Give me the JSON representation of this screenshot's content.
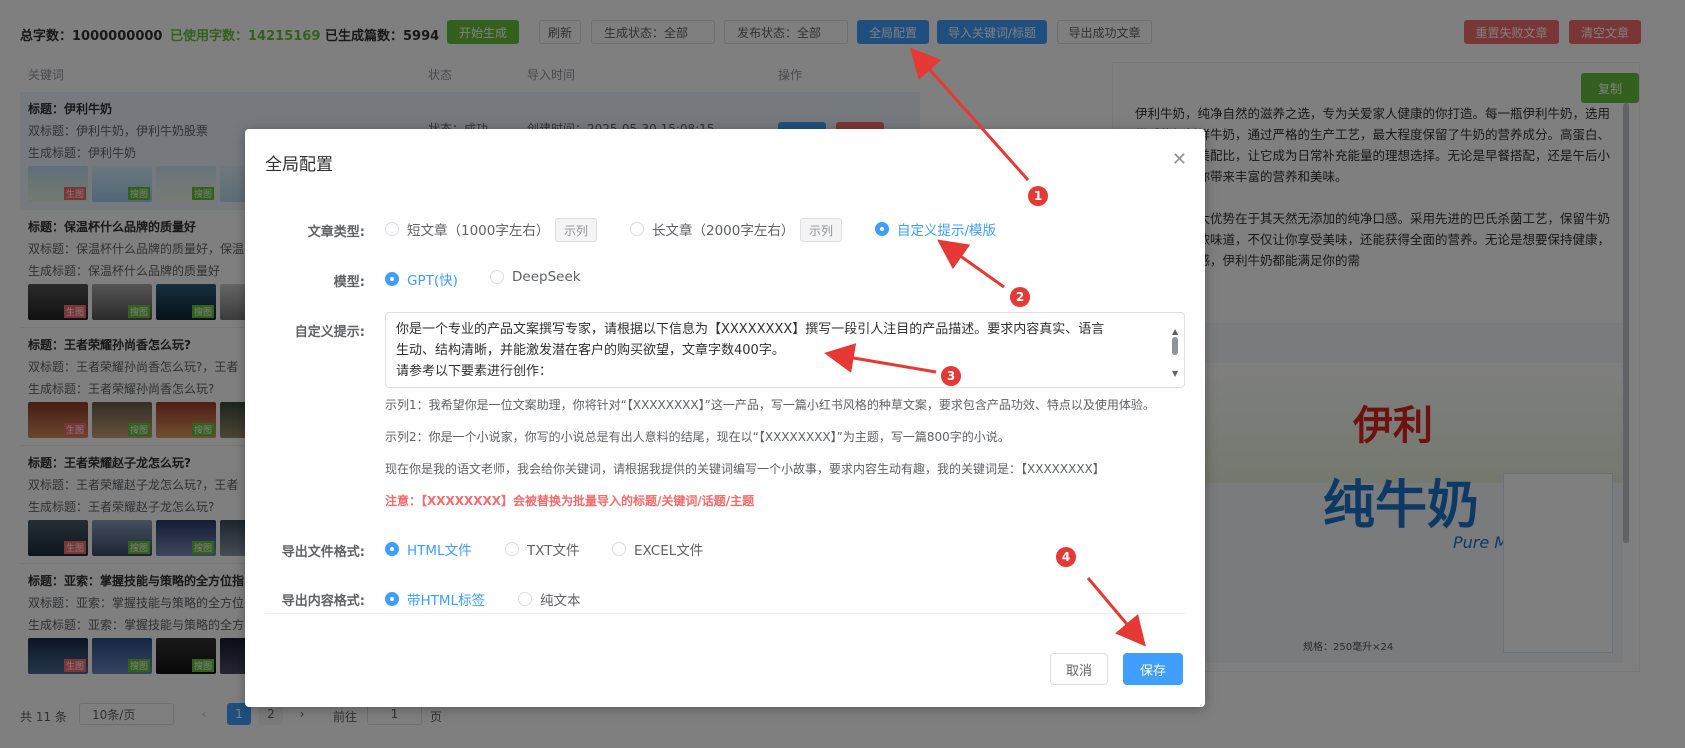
{
  "topbar": {
    "total_chars": "总字数：1000000000",
    "used_chars_label": "已使用字数：",
    "used_chars_value": "14215169",
    "generated_count": "已生成篇数：5994",
    "start_btn": "开始生成",
    "refresh_btn": "刷新",
    "gen_status": "生成状态：全部",
    "pub_status": "发布状态：全部",
    "global_config_btn": "全局配置",
    "import_btn": "导入关键词/标题",
    "export_btn": "导出成功文章",
    "reset_failed_btn": "重置失败文章",
    "clear_btn": "清空文章"
  },
  "table": {
    "headers": [
      "关键词",
      "状态",
      "导入时间",
      "操作"
    ],
    "rows": [
      {
        "title": "标题：伊利牛奶",
        "sub": "双标题：伊利牛奶，伊利牛奶股票",
        "gen": "生成标题：伊利牛奶",
        "status": "状态：成功",
        "time": "创建时间：2025-05-30 15:08:15"
      },
      {
        "title": "标题：保温杯什么品牌的质量好",
        "sub": "双标题：保温杯什么品牌的质量好，保温",
        "gen": "生成标题：保温杯什么品牌的质量好"
      },
      {
        "title": "标题：王者荣耀孙尚香怎么玩?",
        "sub": "双标题：王者荣耀孙尚香怎么玩?，王者",
        "gen": "生成标题：王者荣耀孙尚香怎么玩?"
      },
      {
        "title": "标题：王者荣耀赵子龙怎么玩?",
        "sub": "双标题：王者荣耀赵子龙怎么玩?，王者",
        "gen": "生成标题：王者荣耀赵子龙怎么玩?"
      },
      {
        "title": "标题：亚索：掌握技能与策略的全方位指",
        "sub": "双标题：亚索：掌握技能与策略的全方位",
        "gen": "生成标题：亚索：掌握技能与策略的全方"
      }
    ],
    "tag_main": "生图",
    "tag_search": "搜图"
  },
  "preview": {
    "copy_btn": "复制",
    "para1": "伊利牛奶，纯净自然的滋养之选，专为关爱家人健康的你打造。每一瓶伊利牛奶，选用优质牧场新鲜牛奶，通过严格的生产工艺，最大程度保留了牛奶的营养成分。高蛋白、低脂肪的完美配比，让它成为日常补充能量的理想选择。无论是早餐搭配，还是午后小憩，都能为你带来丰富的营养和美味。",
    "para2": "伊利牛奶最大优势在于其天然无添加的纯净口感。采用先进的巴氏杀菌工艺，保留牛奶最天然的香浓味道，不仅让你享受美味，还能获得全面的营养。无论是想要保持健康，还是追求口感，伊利牛奶都能满足你的需",
    "brand": "伊利",
    "product": "纯牛奶",
    "product_en": "Pure Milk",
    "spec": "规格：250毫升×24"
  },
  "pager": {
    "total": "共 11 条",
    "page_size": "10条/页",
    "pages": [
      "1",
      "2"
    ],
    "goto_label": "前往",
    "goto_value": "1",
    "page_unit": "页"
  },
  "dialog": {
    "title": "全局配置",
    "article_type_label": "文章类型:",
    "opt_short": "短文章（1000字左右）",
    "opt_long": "长文章（2000字左右）",
    "example_btn": "示列",
    "opt_custom": "自定义提示/模版",
    "model_label": "模型:",
    "model_gpt": "GPT(快)",
    "model_deepseek": "DeepSeek",
    "custom_label": "自定义提示:",
    "prompt_text_1": "你是一个专业的产品文案撰写专家，请根据以下信息为【XXXXXXXX】撰写一段引人注目的产品描述。要求内容真实、语言",
    "prompt_text_2": "生动、结构清晰，并能激发潜在客户的购买欲望，文章字数400字。",
    "prompt_text_3": "请参考以下要素进行创作：",
    "example1": "示列1：我希望你是一位文案助理，你将针对“【XXXXXXXX】”这一产品，写一篇小红书风格的种草文案，要求包含产品功效、特点以及使用体验。",
    "example2": "示列2：你是一个小说家，你写的小说总是有出人意料的结尾，现在以“【XXXXXXXX】”为主题，写一篇800字的小说。",
    "example3": "现在你是我的语文老师，我会给你关键词，请根据我提供的关键词编写一个小故事，要求内容生动有趣，我的关键词是：【XXXXXXXX】",
    "note": "注意：【XXXXXXXX】会被替换为批量导入的标题/关键词/话题/主题",
    "export_format_label": "导出文件格式:",
    "fmt_html": "HTML文件",
    "fmt_txt": "TXT文件",
    "fmt_excel": "EXCEL文件",
    "export_content_label": "导出内容格式:",
    "content_html": "带HTML标签",
    "content_plain": "纯文本",
    "cancel_btn": "取消",
    "save_btn": "保存"
  },
  "annotations": [
    "1",
    "2",
    "3",
    "4"
  ],
  "colors": {
    "primary": "#409eff",
    "success": "#67c23a",
    "danger": "#f56c6c",
    "annotation": "#e53935"
  }
}
